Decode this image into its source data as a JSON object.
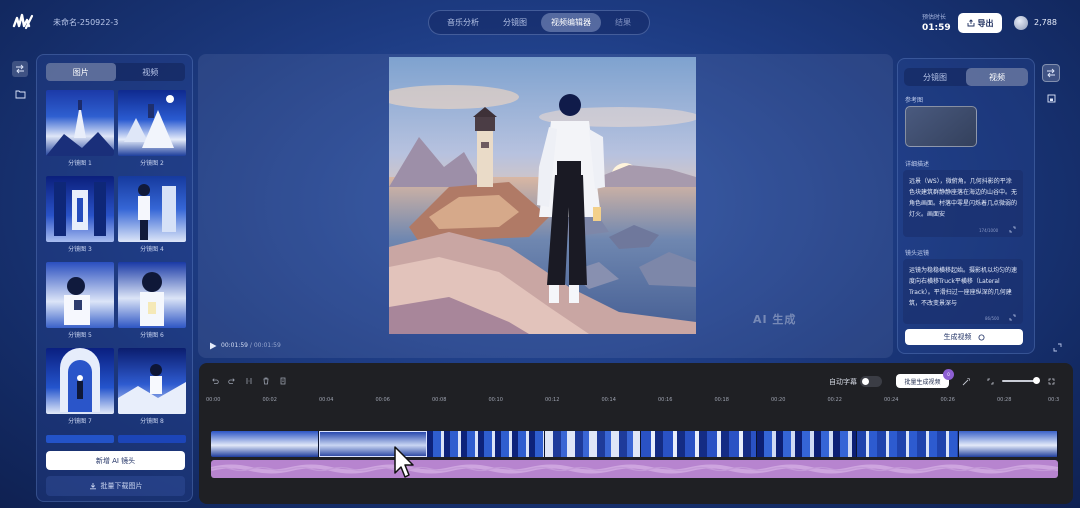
{
  "header": {
    "project_name": "未命名-250922-3",
    "nav_tabs": [
      "音乐分析",
      "分镜图",
      "视频编辑器",
      "结果"
    ],
    "active_tab": "视频编辑器",
    "time_label": "预估时长",
    "time_value": "01:59",
    "export_label": "导出",
    "credits": "2,788"
  },
  "left_panel": {
    "tabs": [
      "图片",
      "视频"
    ],
    "active_tab": "图片",
    "thumbnails": [
      {
        "label": "分镜图 1"
      },
      {
        "label": "分镜图 2"
      },
      {
        "label": "分镜图 3"
      },
      {
        "label": "分镜图 4"
      },
      {
        "label": "分镜图 5"
      },
      {
        "label": "分镜图 6"
      },
      {
        "label": "分镜图 7"
      },
      {
        "label": "分镜图 8"
      }
    ],
    "add_shot_label": "新增 AI 镜头",
    "download_label": "批量下载图片"
  },
  "preview": {
    "watermark": "AI 生成",
    "current_time": "00:01:59",
    "total_time": "00:01:59"
  },
  "right_panel": {
    "tabs": [
      "分镜图",
      "视频"
    ],
    "active_tab": "视频",
    "reference_label": "参考图",
    "detail_label": "详细描述",
    "detail_text": "远景（WS），微俯角。几何抖影的平涂色块建筑群静静座落在海边的山谷中。无角色画面。村落中零星闪烁着几点微弱的灯火。画面安",
    "detail_count": "174/1000",
    "camera_label": "镜头运镜",
    "camera_text": "运镜为稳稳横移起始。摄影机以均匀的速度向右横移Truck平横移（Lateral Track）。平滑扫过一座座纵深的几何建筑，不改变景深与",
    "camera_count": "86/500",
    "generate_label": "生成视频"
  },
  "timeline": {
    "subtitle_label": "自动字幕",
    "batch_label": "批量生成视频",
    "batch_badge": "0",
    "ticks": [
      "00:00",
      "00:02",
      "00:04",
      "00:06",
      "00:08",
      "00:10",
      "00:12",
      "00:14",
      "00:16",
      "00:18",
      "00:20",
      "00:22",
      "00:24",
      "00:26",
      "00:28",
      "00:3"
    ]
  },
  "colors": {
    "background": "#1d3b82",
    "timeline_bg": "#1f2024",
    "audio_track": "#b784cf",
    "accent_badge": "#8d5fd3"
  }
}
